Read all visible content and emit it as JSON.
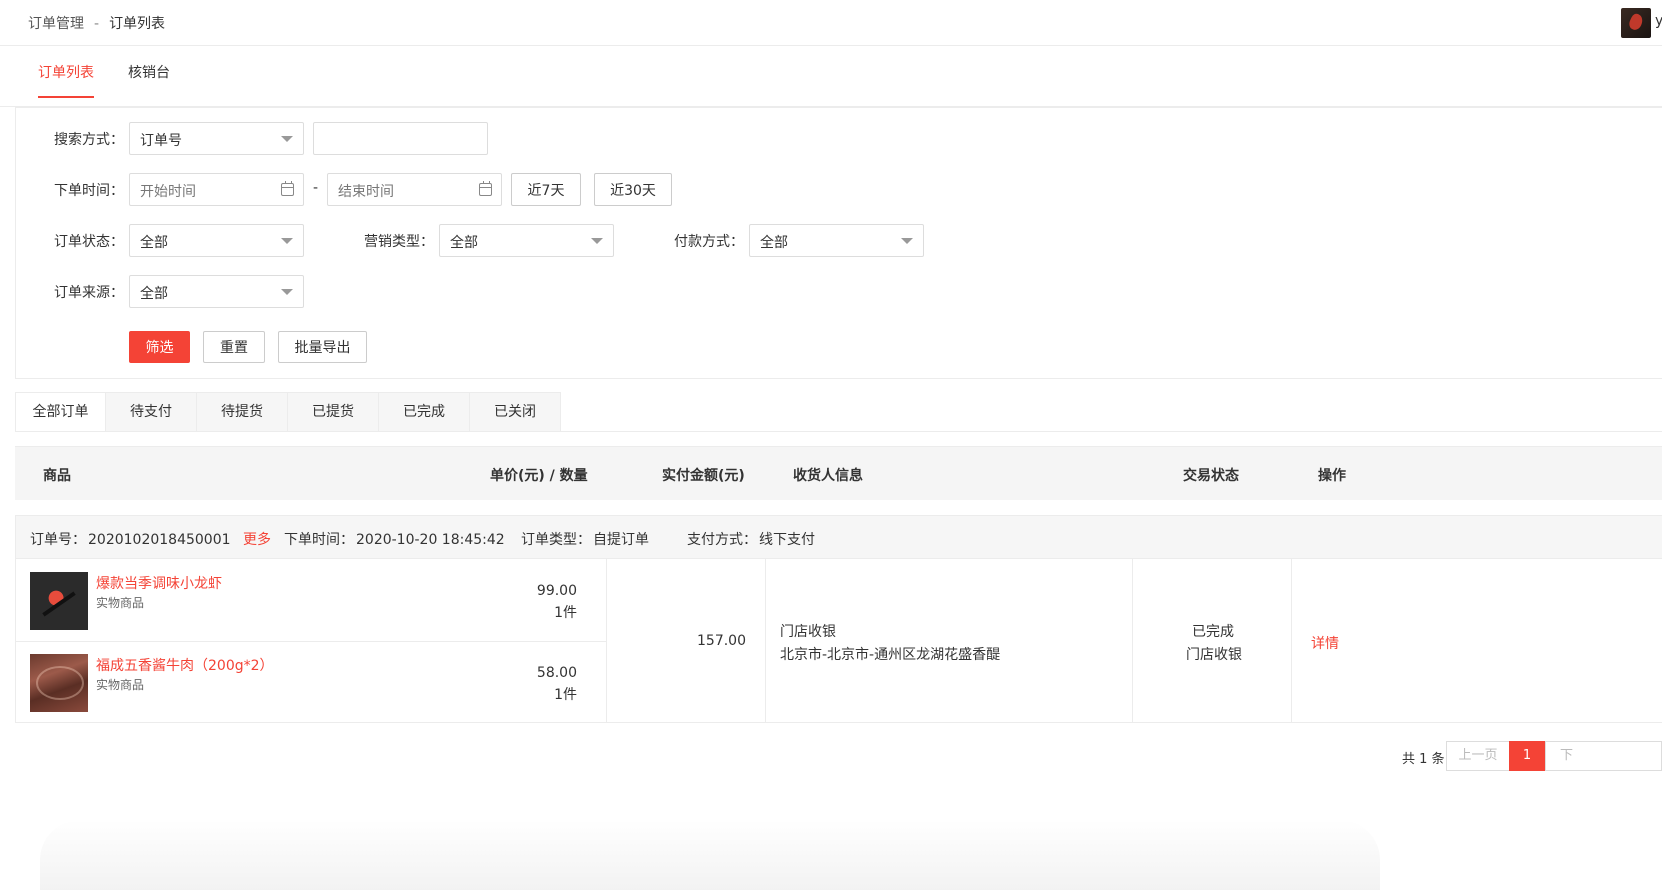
{
  "header": {
    "breadcrumb": [
      "订单管理",
      "订单列表"
    ],
    "breadcrumb_sep": "-",
    "user_initial": "y"
  },
  "subtabs": [
    "订单列表",
    "核销台"
  ],
  "filter": {
    "search_label": "搜索方式：",
    "search_type": "订单号",
    "search_value": "",
    "time_label": "下单时间：",
    "start_placeholder": "开始时间",
    "end_placeholder": "结束时间",
    "range_sep": "-",
    "quick_7": "近7天",
    "quick_30": "近30天",
    "status_label": "订单状态：",
    "status_value": "全部",
    "marketing_label": "营销类型：",
    "marketing_value": "全部",
    "pay_label": "付款方式：",
    "pay_value": "全部",
    "source_label": "订单来源：",
    "source_value": "全部",
    "filter_btn": "筛选",
    "reset_btn": "重置",
    "export_btn": "批量导出"
  },
  "status_tabs": [
    "全部订单",
    "待支付",
    "待提货",
    "已提货",
    "已完成",
    "已关闭"
  ],
  "table_headers": {
    "goods": "商品",
    "price_qty": "单价(元) / 数量",
    "paid": "实付金额(元)",
    "receiver": "收货人信息",
    "status": "交易状态",
    "action": "操作"
  },
  "order": {
    "no_label": "订单号：",
    "no": "2020102018450001",
    "more": "更多",
    "time_label": "下单时间：",
    "time": "2020-10-20 18:45:42",
    "type_label": "订单类型：",
    "type": "自提订单",
    "pay_label": "支付方式：",
    "pay": "线下支付",
    "items": [
      {
        "name": "爆款当季调味小龙虾",
        "kind": "实物商品",
        "price": "99.00",
        "qty": "1件"
      },
      {
        "name": "福成五香酱牛肉（200g*2）",
        "kind": "实物商品",
        "price": "58.00",
        "qty": "1件"
      }
    ],
    "paid": "157.00",
    "receiver_name": "门店收银",
    "receiver_addr": "北京市-北京市-通州区龙湖花盛香醍",
    "status": "已完成",
    "status_sub": "门店收银",
    "action": "详情"
  },
  "pager": {
    "total": "共 1 条",
    "prev": "上一页",
    "current": "1",
    "next": "下"
  }
}
